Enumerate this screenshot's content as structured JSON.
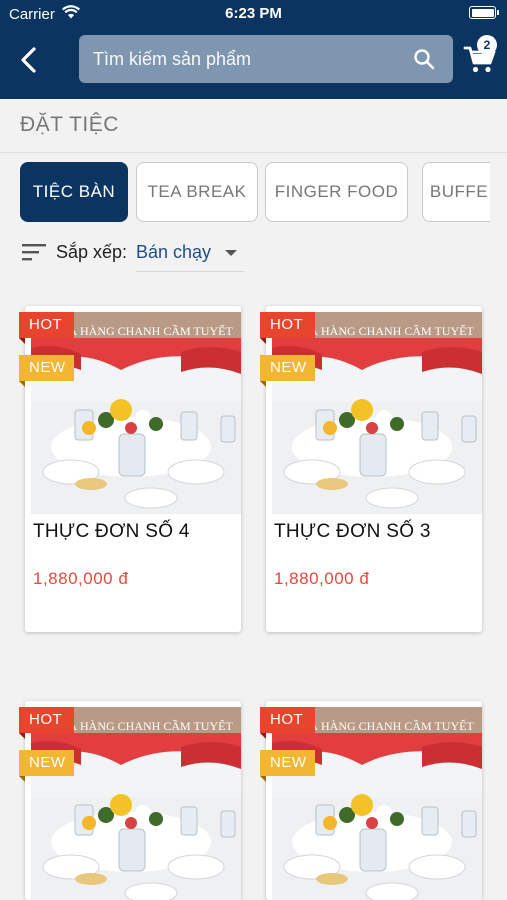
{
  "status_bar": {
    "carrier": "Carrier",
    "time": "6:23 PM"
  },
  "header": {
    "search_placeholder": "Tìm kiếm sản phẩm",
    "cart_count": "2"
  },
  "section_title": "ĐẶT TIỆC",
  "tabs": [
    {
      "label": "TIỆC BÀN",
      "active": true
    },
    {
      "label": "TEA BREAK",
      "active": false
    },
    {
      "label": "FINGER FOOD",
      "active": false
    },
    {
      "label": "BUFFE",
      "active": false
    }
  ],
  "sort": {
    "label": "Sắp xếp:",
    "value": "Bán chạy"
  },
  "products": [
    {
      "name": "THỰC ĐƠN SỐ 4",
      "price": "1,880,000 đ",
      "tags": [
        "HOT",
        "NEW"
      ],
      "watermark": "NHÀ HÀNG CHANH CẦM TUYẾT"
    },
    {
      "name": "THỰC ĐƠN SỐ 3",
      "price": "1,880,000 đ",
      "tags": [
        "HOT",
        "NEW"
      ],
      "watermark": "NHÀ HÀNG CHANH CẦM TUYẾT"
    },
    {
      "name": "",
      "price": "",
      "tags": [
        "HOT",
        "NEW"
      ],
      "watermark": "NHÀ HÀNG CHANH CẦM TUYẾT"
    },
    {
      "name": "",
      "price": "",
      "tags": [
        "HOT",
        "NEW"
      ],
      "watermark": "NHÀ HÀNG CHANH CẦM TUYẾT"
    }
  ],
  "colors": {
    "brand": "#0b3460",
    "price": "#e8483b",
    "hot": "#e8452f",
    "new": "#f2b534"
  }
}
